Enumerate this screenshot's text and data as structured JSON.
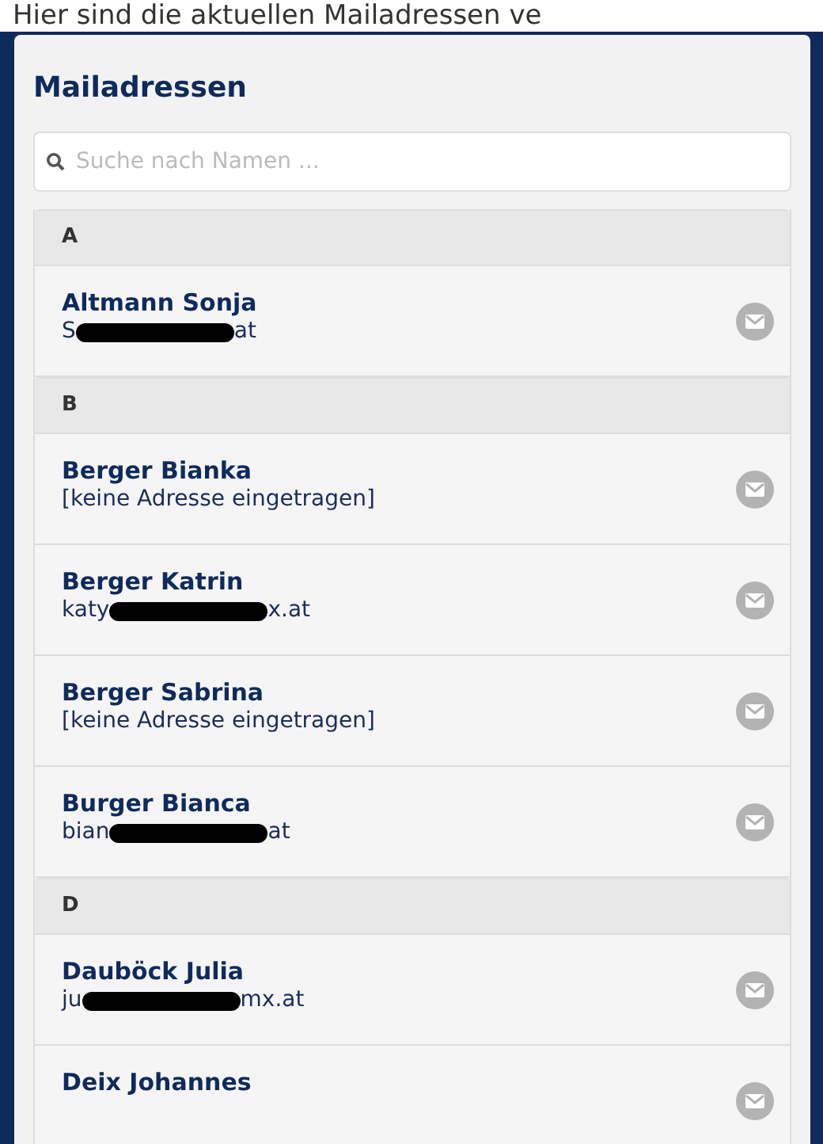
{
  "caption": "Hier sind die aktuellen Mailadressen ve",
  "panel": {
    "title": "Mailadressen",
    "search": {
      "placeholder": "Suche nach Namen ..."
    }
  },
  "groups": [
    {
      "letter": "A",
      "contacts": [
        {
          "name": "Altmann Sonja",
          "email": [
            {
              "kind": "text",
              "text": "S"
            },
            {
              "kind": "redacted"
            },
            {
              "kind": "text",
              "text": "at"
            }
          ]
        }
      ]
    },
    {
      "letter": "B",
      "contacts": [
        {
          "name": "Berger Bianka",
          "email": [
            {
              "kind": "text",
              "text": "[keine Adresse eingetragen]"
            }
          ]
        },
        {
          "name": "Berger Katrin",
          "email": [
            {
              "kind": "text",
              "text": "katy"
            },
            {
              "kind": "redacted"
            },
            {
              "kind": "text",
              "text": "x.at"
            }
          ]
        },
        {
          "name": "Berger Sabrina",
          "email": [
            {
              "kind": "text",
              "text": "[keine Adresse eingetragen]"
            }
          ]
        },
        {
          "name": "Burger Bianca",
          "email": [
            {
              "kind": "text",
              "text": "bian"
            },
            {
              "kind": "redacted"
            },
            {
              "kind": "text",
              "text": "at"
            }
          ]
        }
      ]
    },
    {
      "letter": "D",
      "contacts": [
        {
          "name": "Dauböck Julia",
          "email": [
            {
              "kind": "text",
              "text": "ju"
            },
            {
              "kind": "redacted"
            },
            {
              "kind": "text",
              "text": "mx.at"
            }
          ]
        },
        {
          "name": "Deix Johannes"
        }
      ]
    }
  ]
}
